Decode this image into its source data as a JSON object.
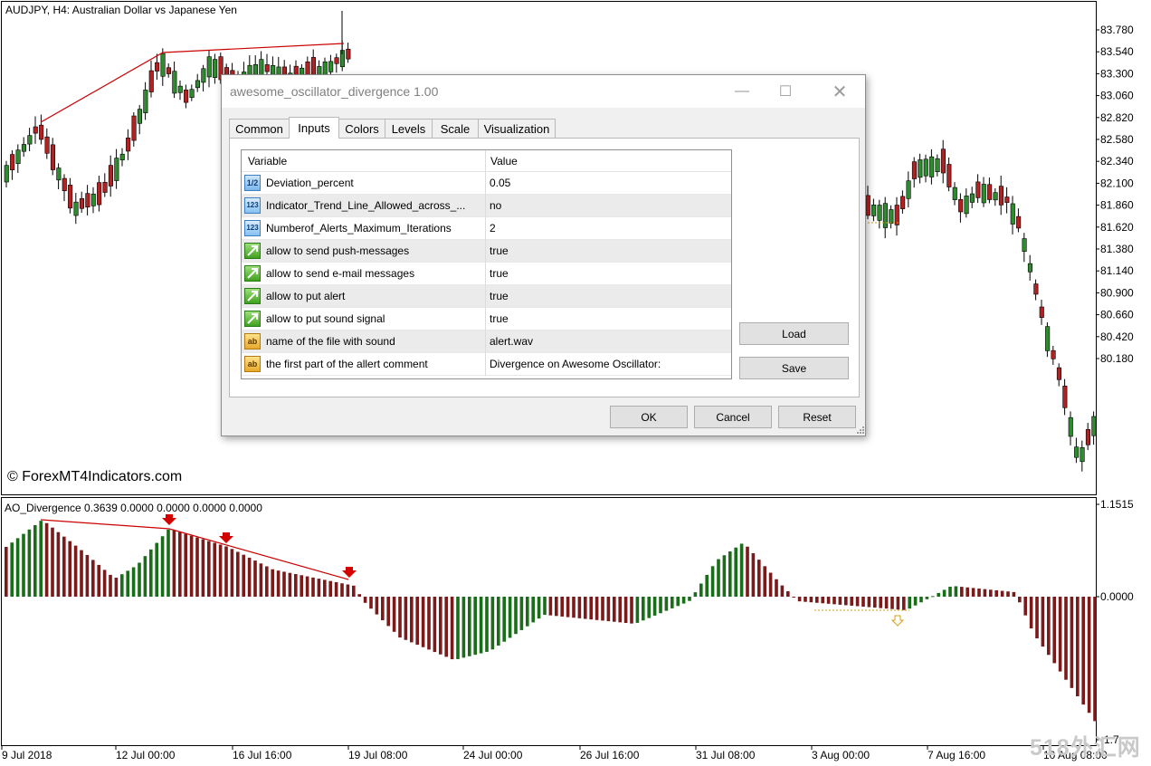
{
  "chart": {
    "title": "AUDJPY, H4:  Australian Dollar vs Japanese Yen",
    "price_labels": [
      "83.780",
      "83.540",
      "83.300",
      "83.060",
      "82.820",
      "82.580",
      "82.340",
      "82.100",
      "81.860",
      "81.620",
      "81.380",
      "81.140",
      "80.900",
      "80.660",
      "80.420",
      "80.180"
    ],
    "watermark": "© ForexMT4Indicators.com",
    "colors": {
      "bull": "#2e8b2e",
      "bear": "#b22222",
      "trendline": "#cc0000",
      "sub_green": "#1a6e1a",
      "sub_red": "#7a1a1a"
    }
  },
  "oscillator": {
    "header": "AO_Divergence 0.3639 0.0000 0.0000 0.0000 0.0000",
    "scale_labels": [
      "1.1515",
      "0.0000",
      "-1.7..."
    ]
  },
  "time_axis": [
    "9 Jul 2018",
    "12 Jul 00:00",
    "16 Jul 16:00",
    "19 Jul 08:00",
    "24 Jul 00:00",
    "26 Jul 16:00",
    "31 Jul 08:00",
    "3 Aug 00:00",
    "7 Aug 16:00",
    "10 Aug 08:00"
  ],
  "dialog": {
    "title": "awesome_oscillator_divergence 1.00",
    "tabs": [
      "Common",
      "Inputs",
      "Colors",
      "Levels",
      "Scale",
      "Visualization"
    ],
    "active_tab": "Inputs",
    "grid_headers": {
      "variable": "Variable",
      "value": "Value"
    },
    "inputs": [
      {
        "icon": "fraction-icon",
        "glyph": "1/2",
        "name": "Deviation_percent",
        "value": "0.05"
      },
      {
        "icon": "integer-icon",
        "glyph": "123",
        "name": "Indicator_Trend_Line_Allowed_across_...",
        "value": "no"
      },
      {
        "icon": "integer-icon",
        "glyph": "123",
        "name": "Numberof_Alerts_Maximum_Iterations",
        "value": "2"
      },
      {
        "icon": "bool-icon",
        "glyph": "",
        "name": "allow to send push-messages",
        "value": "true"
      },
      {
        "icon": "bool-icon",
        "glyph": "",
        "name": "allow to send e-mail messages",
        "value": "true"
      },
      {
        "icon": "bool-icon",
        "glyph": "",
        "name": "allow to put alert",
        "value": "true"
      },
      {
        "icon": "bool-icon",
        "glyph": "",
        "name": "allow to put sound signal",
        "value": "true"
      },
      {
        "icon": "string-icon",
        "glyph": "ab",
        "name": "name of the file with sound",
        "value": "alert.wav"
      },
      {
        "icon": "string-icon",
        "glyph": "ab",
        "name": "the first part of the allert comment",
        "value": "Divergence on Awesome Oscillator:"
      }
    ],
    "side_buttons": {
      "load": "Load",
      "save": "Save"
    },
    "footer_buttons": {
      "ok": "OK",
      "cancel": "Cancel",
      "reset": "Reset"
    }
  },
  "corner_mark": "518外汇网"
}
